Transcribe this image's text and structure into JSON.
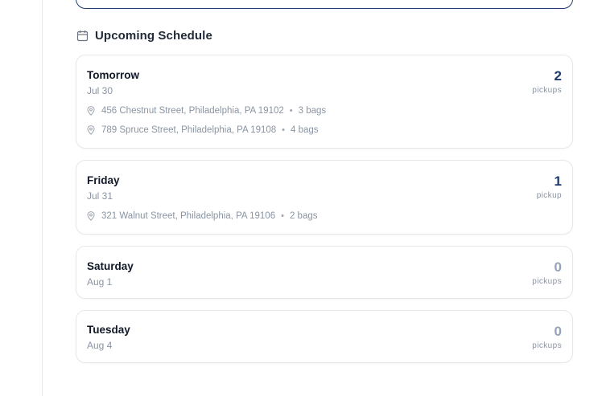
{
  "section": {
    "title": "Upcoming Schedule",
    "icon": "calendar-icon"
  },
  "days": [
    {
      "name": "Tomorrow",
      "date": "Jul 30",
      "count": "2",
      "count_label": "pickups",
      "pickups": [
        {
          "address": "456 Chestnut Street, Philadelphia, PA 19102",
          "bags": "3 bags"
        },
        {
          "address": "789 Spruce Street, Philadelphia, PA 19108",
          "bags": "4 bags"
        }
      ]
    },
    {
      "name": "Friday",
      "date": "Jul 31",
      "count": "1",
      "count_label": "pickup",
      "pickups": [
        {
          "address": "321 Walnut Street, Philadelphia, PA 19106",
          "bags": "2 bags"
        }
      ]
    },
    {
      "name": "Saturday",
      "date": "Aug 1",
      "count": "0",
      "count_label": "pickups",
      "pickups": []
    },
    {
      "name": "Tuesday",
      "date": "Aug 4",
      "count": "0",
      "count_label": "pickups",
      "pickups": []
    }
  ],
  "separator": "•",
  "colors": {
    "accent": "#1e3a6e",
    "muted": "#8a94a3",
    "zero": "#94a3b8",
    "border": "#e5e7eb"
  }
}
